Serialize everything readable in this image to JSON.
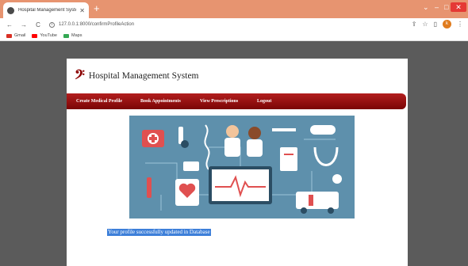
{
  "browser": {
    "tab_title": "Hospital Management System",
    "address": "127.0.0.1:8000/confirmProfileAction",
    "avatar_letter": "k",
    "accent_color": "#e79470",
    "bookmarks": [
      {
        "label": "Gmail",
        "icon": "gmail-icon"
      },
      {
        "label": "YouTube",
        "icon": "youtube-icon"
      },
      {
        "label": "Maps",
        "icon": "maps-icon"
      }
    ]
  },
  "site": {
    "title": "Hospital Management System",
    "menu": [
      "Create Medical Profile",
      "Book Appointments",
      "View Prescriptions",
      "Logout"
    ]
  },
  "message": "Your profile successfully updated in Database"
}
